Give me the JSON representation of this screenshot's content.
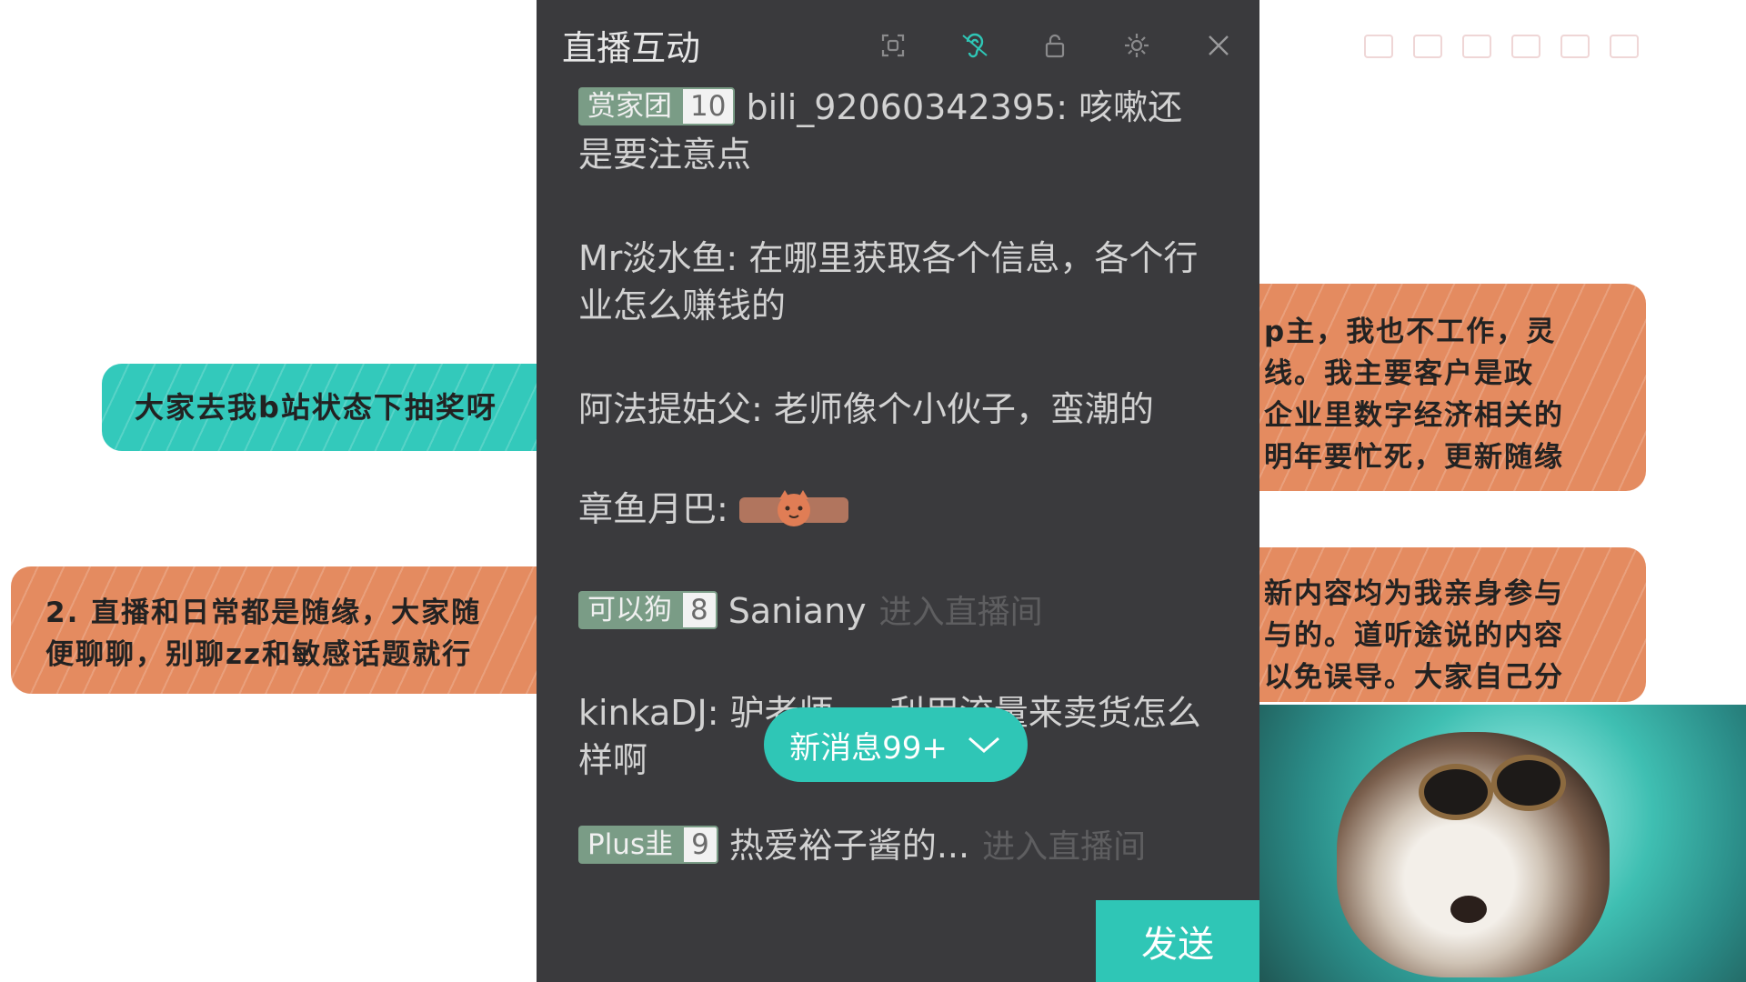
{
  "background": {
    "note_lottery": "大家去我b站状态下抽奖呀",
    "note_rules": [
      "2. 直播和日常都是随缘，大家随",
      "便聊聊，别聊zz和敏感话题就行"
    ],
    "note_right1": [
      "p主，我也不工作，灵",
      "线。我主要客户是政",
      "企业里数字经济相关的",
      "明年要忙死，更新随缘"
    ],
    "note_right2": [
      "新内容均为我亲身参与",
      "与的。道听途说的内容",
      "以免误导。大家自己分"
    ],
    "accent_teal": "#33c9bb",
    "accent_orange": "#e48b60"
  },
  "panel": {
    "title": "直播互动",
    "toolbar_icons": [
      "picture-in-picture-icon",
      "ear-icon",
      "lock-icon",
      "gear-icon",
      "close-icon"
    ],
    "messages": [
      {
        "badge_name": "赏家团",
        "badge_level": "10",
        "user": "bili_92060342395",
        "text": "咳嗽还是要注意点"
      },
      {
        "user": "Mr淡水鱼",
        "text": "在哪里获取各个信息，各个行业怎么赚钱的"
      },
      {
        "user": "阿法提姑父",
        "text": "老师像个小伙子，蛮潮的"
      },
      {
        "user": "章鱼月巴",
        "emote": "cat-emote"
      },
      {
        "badge_name": "可以狗",
        "badge_level": "8",
        "user": "Saniany",
        "hint": "进入直播间"
      },
      {
        "user": "kinkaDJ",
        "text": "驴老师，..利用流量来卖货怎么样啊"
      },
      {
        "badge_name": "Plus韭",
        "badge_level": "9",
        "user": "热爱裕子酱的...",
        "hint": "进入直播间"
      }
    ],
    "new_messages_label": "新消息99+",
    "send_label": "发送",
    "accent": "#2fc6b6"
  }
}
